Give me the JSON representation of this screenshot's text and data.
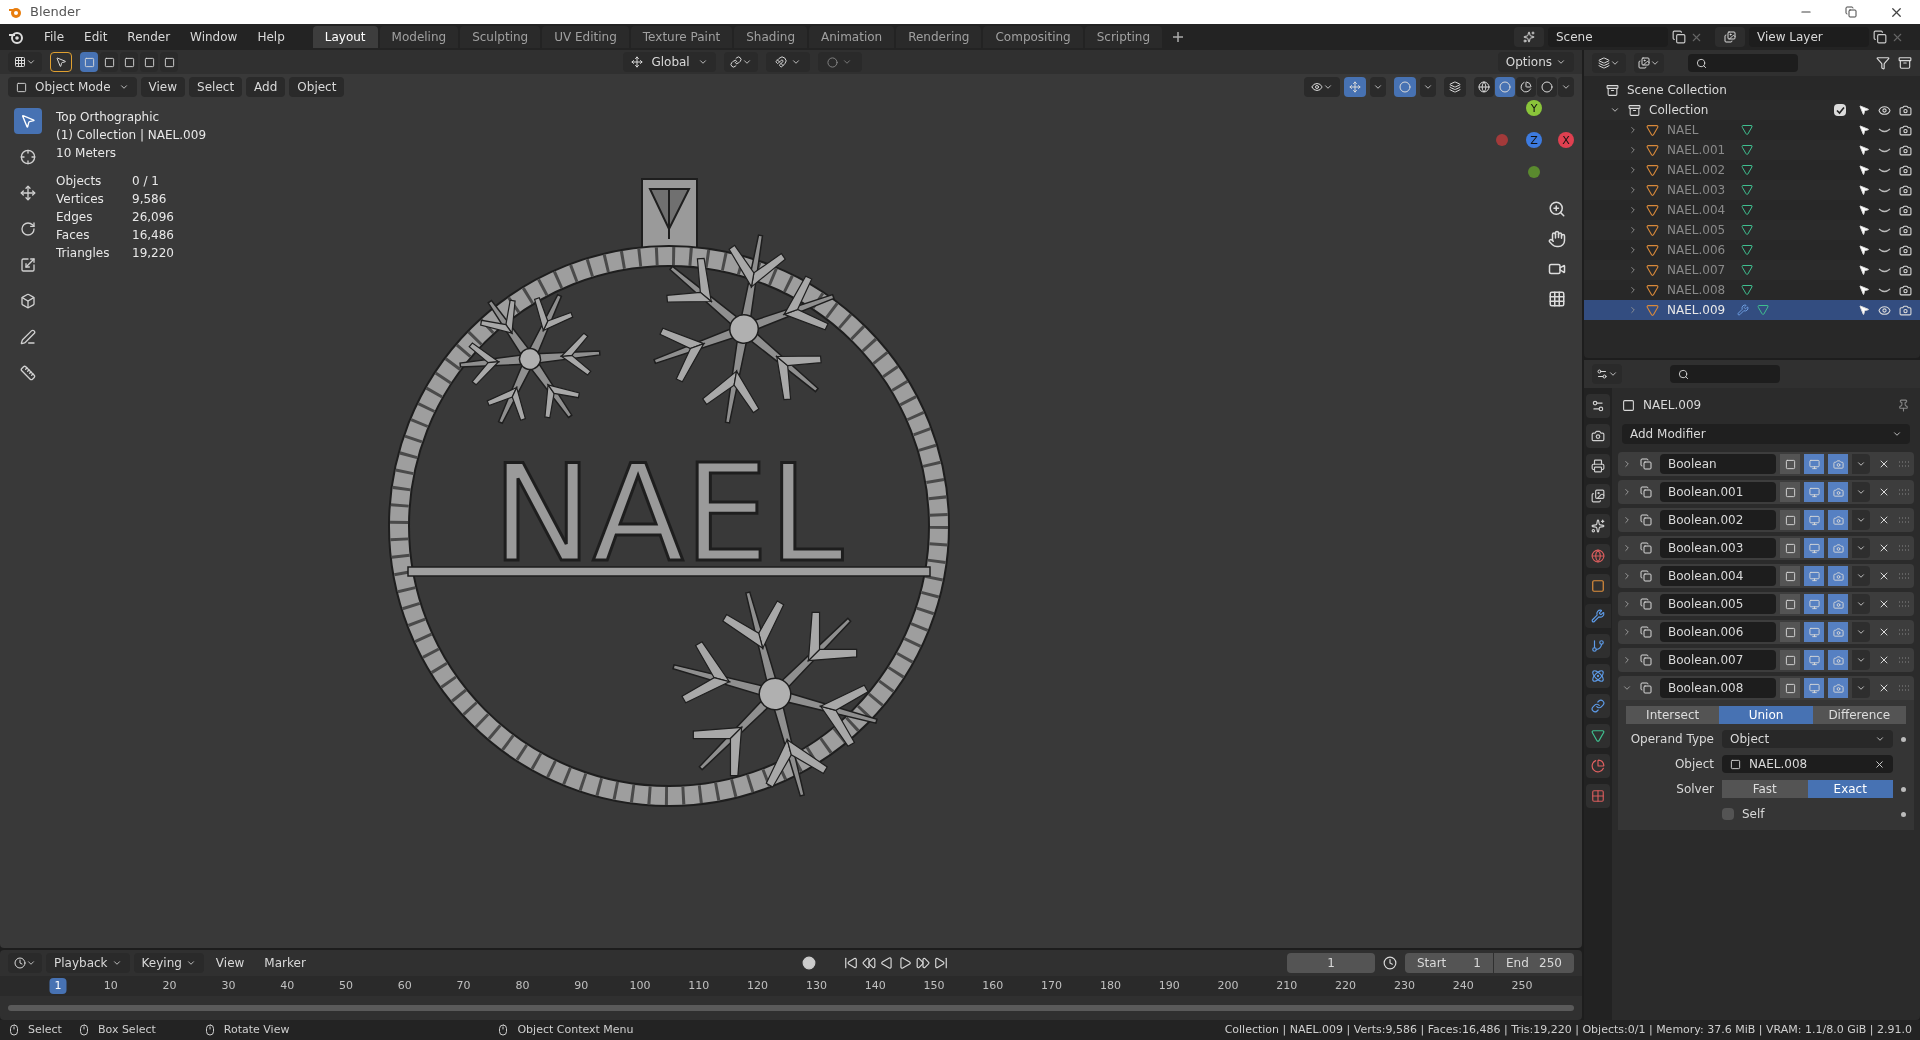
{
  "window": {
    "title": "Blender"
  },
  "menu": [
    "File",
    "Edit",
    "Render",
    "Window",
    "Help"
  ],
  "workspaces": [
    {
      "label": "Layout",
      "selected": true
    },
    {
      "label": "Modeling",
      "selected": false
    },
    {
      "label": "Sculpting",
      "selected": false
    },
    {
      "label": "UV Editing",
      "selected": false
    },
    {
      "label": "Texture Paint",
      "selected": false
    },
    {
      "label": "Shading",
      "selected": false
    },
    {
      "label": "Animation",
      "selected": false
    },
    {
      "label": "Rendering",
      "selected": false
    },
    {
      "label": "Compositing",
      "selected": false
    },
    {
      "label": "Scripting",
      "selected": false
    }
  ],
  "scene": "Scene",
  "view_layer": "View Layer",
  "tool_header": {
    "orientation": "Global",
    "options": "Options",
    "selection_modes": [
      {
        "selected": true
      },
      {
        "selected": false
      },
      {
        "selected": false
      },
      {
        "selected": false
      },
      {
        "selected": false
      }
    ]
  },
  "viewport_header": {
    "mode": "Object Mode",
    "menus": [
      "View",
      "Select",
      "Add",
      "Object"
    ],
    "gizmos_on": true,
    "overlays_on": true,
    "shading": [
      {
        "kind": "wireframe",
        "selected": false
      },
      {
        "kind": "solid",
        "selected": true
      },
      {
        "kind": "material",
        "selected": false
      },
      {
        "kind": "rendered",
        "selected": false
      }
    ]
  },
  "tools": [
    {
      "kind": "select",
      "selected": true
    },
    {
      "kind": "cursor",
      "selected": false
    },
    {
      "kind": "move",
      "selected": false
    },
    {
      "kind": "rotate",
      "selected": false
    },
    {
      "kind": "scale",
      "selected": false
    },
    {
      "kind": "transform",
      "selected": false
    },
    {
      "kind": "annotate",
      "selected": false
    },
    {
      "kind": "measure",
      "selected": false
    }
  ],
  "viewport": {
    "view_name": "Top Orthographic",
    "collection_line": "(1) Collection | NAEL.009",
    "scale": "10 Meters",
    "stats": [
      {
        "label": "Objects",
        "value": "0 / 1"
      },
      {
        "label": "Vertices",
        "value": "9,586"
      },
      {
        "label": "Edges",
        "value": "26,096"
      },
      {
        "label": "Faces",
        "value": "16,486"
      },
      {
        "label": "Triangles",
        "value": "19,220"
      }
    ],
    "ornament_text": "NAEL",
    "gizmo_axes": [
      "Y",
      "Z",
      "X"
    ]
  },
  "outliner": {
    "root": "Scene Collection",
    "collection": {
      "label": "Collection",
      "expanded": true,
      "checked": true,
      "children": [
        {
          "label": "NAEL",
          "selected": false,
          "visible": false,
          "modifier": false
        },
        {
          "label": "NAEL.001",
          "selected": false,
          "visible": false,
          "modifier": false
        },
        {
          "label": "NAEL.002",
          "selected": false,
          "visible": false,
          "modifier": false
        },
        {
          "label": "NAEL.003",
          "selected": false,
          "visible": false,
          "modifier": false
        },
        {
          "label": "NAEL.004",
          "selected": false,
          "visible": false,
          "modifier": false
        },
        {
          "label": "NAEL.005",
          "selected": false,
          "visible": false,
          "modifier": false
        },
        {
          "label": "NAEL.006",
          "selected": false,
          "visible": false,
          "modifier": false
        },
        {
          "label": "NAEL.007",
          "selected": false,
          "visible": false,
          "modifier": false
        },
        {
          "label": "NAEL.008",
          "selected": false,
          "visible": false,
          "modifier": false
        },
        {
          "label": "NAEL.009",
          "selected": true,
          "visible": true,
          "modifier": true
        }
      ]
    }
  },
  "property_tabs": [
    {
      "kind": "tool",
      "selected": false
    },
    {
      "kind": "render",
      "selected": false
    },
    {
      "kind": "output",
      "selected": false
    },
    {
      "kind": "view_layer",
      "selected": false
    },
    {
      "kind": "scene",
      "selected": false
    },
    {
      "kind": "world",
      "selected": false
    },
    {
      "kind": "object",
      "selected": false
    },
    {
      "kind": "modifiers",
      "selected": true
    },
    {
      "kind": "particles",
      "selected": false
    },
    {
      "kind": "physics",
      "selected": false
    },
    {
      "kind": "constraints",
      "selected": false
    },
    {
      "kind": "data",
      "selected": false
    },
    {
      "kind": "material",
      "selected": false
    },
    {
      "kind": "texture",
      "selected": false
    }
  ],
  "properties": {
    "object_name": "NAEL.009",
    "add_modifier": "Add Modifier",
    "modifiers": [
      {
        "name": "Boolean",
        "expanded": false,
        "edit_mode": false,
        "viewport": true,
        "render": true
      },
      {
        "name": "Boolean.001",
        "expanded": false,
        "edit_mode": false,
        "viewport": true,
        "render": true
      },
      {
        "name": "Boolean.002",
        "expanded": false,
        "edit_mode": false,
        "viewport": true,
        "render": true
      },
      {
        "name": "Boolean.003",
        "expanded": false,
        "edit_mode": false,
        "viewport": true,
        "render": true
      },
      {
        "name": "Boolean.004",
        "expanded": false,
        "edit_mode": false,
        "viewport": true,
        "render": true
      },
      {
        "name": "Boolean.005",
        "expanded": false,
        "edit_mode": false,
        "viewport": true,
        "render": true
      },
      {
        "name": "Boolean.006",
        "expanded": false,
        "edit_mode": false,
        "viewport": true,
        "render": true
      },
      {
        "name": "Boolean.007",
        "expanded": false,
        "edit_mode": false,
        "viewport": true,
        "render": true
      },
      {
        "name": "Boolean.008",
        "expanded": true,
        "edit_mode": false,
        "viewport": true,
        "render": true
      }
    ],
    "boolean": {
      "operations": [
        {
          "label": "Intersect",
          "selected": false
        },
        {
          "label": "Union",
          "selected": true
        },
        {
          "label": "Difference",
          "selected": false
        }
      ],
      "operand_type_label": "Operand Type",
      "operand_type": "Object",
      "object_label": "Object",
      "object": "NAEL.008",
      "solver_label": "Solver",
      "solvers": [
        {
          "label": "Fast",
          "selected": false
        },
        {
          "label": "Exact",
          "selected": true
        }
      ],
      "self": {
        "label": "Self",
        "checked": false
      }
    }
  },
  "timeline": {
    "menus": [
      "Playback",
      "Keying",
      "View",
      "Marker"
    ],
    "current_frame": "1",
    "start_label": "Start",
    "start": "1",
    "end_label": "End",
    "end": "250",
    "ruler": [
      {
        "label": "1",
        "selected": true
      },
      {
        "label": "10",
        "selected": false
      },
      {
        "label": "20",
        "selected": false
      },
      {
        "label": "30",
        "selected": false
      },
      {
        "label": "40",
        "selected": false
      },
      {
        "label": "50",
        "selected": false
      },
      {
        "label": "60",
        "selected": false
      },
      {
        "label": "70",
        "selected": false
      },
      {
        "label": "80",
        "selected": false
      },
      {
        "label": "90",
        "selected": false
      },
      {
        "label": "100",
        "selected": false
      },
      {
        "label": "110",
        "selected": false
      },
      {
        "label": "120",
        "selected": false
      },
      {
        "label": "130",
        "selected": false
      },
      {
        "label": "140",
        "selected": false
      },
      {
        "label": "150",
        "selected": false
      },
      {
        "label": "160",
        "selected": false
      },
      {
        "label": "170",
        "selected": false
      },
      {
        "label": "180",
        "selected": false
      },
      {
        "label": "190",
        "selected": false
      },
      {
        "label": "200",
        "selected": false
      },
      {
        "label": "210",
        "selected": false
      },
      {
        "label": "220",
        "selected": false
      },
      {
        "label": "230",
        "selected": false
      },
      {
        "label": "240",
        "selected": false
      },
      {
        "label": "250",
        "selected": false
      }
    ]
  },
  "status_bar": {
    "hints": [
      "Select",
      "Box Select",
      "Rotate View",
      "Object Context Menu"
    ],
    "stats": "Collection | NAEL.009 | Verts:9,586 | Faces:16,486 | Tris:19,220 | Objects:0/1 | Memory: 37.6 MiB | VRAM: 1.1/8.0 GiB | 2.91.0"
  }
}
